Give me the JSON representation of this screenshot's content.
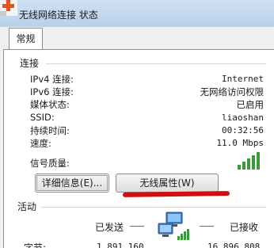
{
  "window": {
    "title": "无线网络连接 状态",
    "app_icon": "network-app-icon",
    "accent_color": "#e8501d"
  },
  "tabs": [
    {
      "label": "常规",
      "selected": true
    }
  ],
  "connection": {
    "section_title": "连接",
    "rows": [
      {
        "label": "IPv4 连接:",
        "value": "Internet"
      },
      {
        "label": "IPv6 连接:",
        "value": "无网络访问权限"
      },
      {
        "label": "媒体状态:",
        "value": "已启用"
      },
      {
        "label": "SSID:",
        "value": "liaoshan"
      },
      {
        "label": "持续时间:",
        "value": "00:32:56"
      },
      {
        "label": "速度:",
        "value": "11.0 Mbps"
      }
    ],
    "signal_label": "信号质量:",
    "signal_icon": "signal-bars-icon",
    "signal_bars_lit": 5,
    "signal_bars_total": 5
  },
  "buttons": {
    "details": "详细信息(E)...",
    "wireless_properties": "无线属性(W)"
  },
  "annotation": {
    "color": "#d10f0f"
  },
  "activity": {
    "section_title": "活动",
    "sent_label": "已发送",
    "received_label": "已接收",
    "bytes_label": "字节:",
    "bytes_sent": "1,891,160",
    "bytes_received": "16,896,808",
    "icon": "network-computers-icon"
  }
}
